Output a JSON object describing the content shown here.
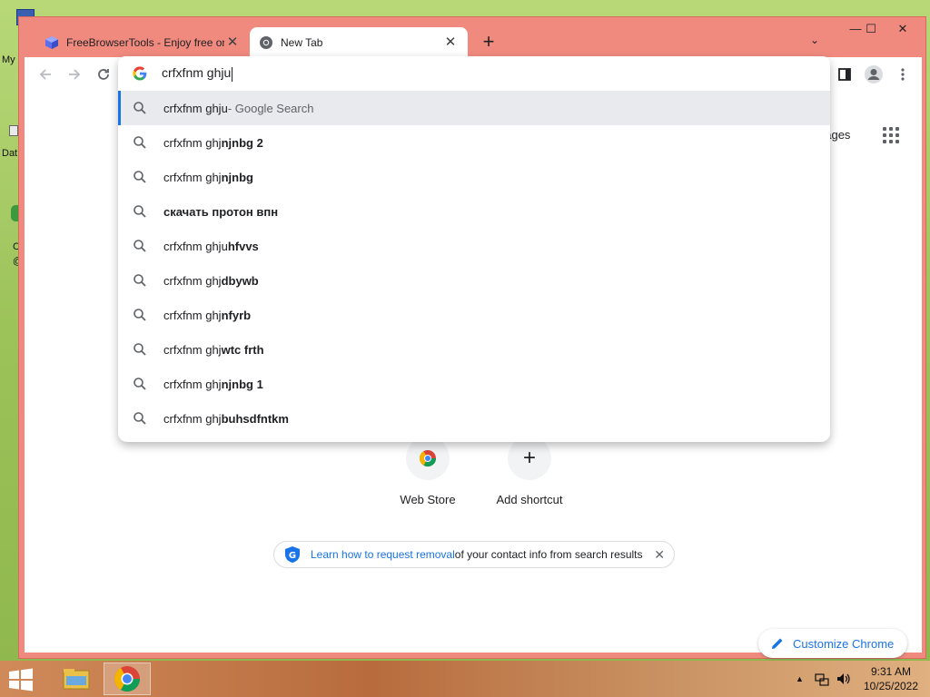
{
  "desktop": {
    "labels": [
      "My",
      "Dat",
      "C",
      "@"
    ]
  },
  "window": {
    "tabs": [
      {
        "title": "FreeBrowserTools - Enjoy free on",
        "close": "✕",
        "active": false
      },
      {
        "title": "New Tab",
        "close": "✕",
        "active": true
      }
    ],
    "new_tab_glyph": "+",
    "tab_list_glyph": "⌄",
    "controls": {
      "minimize": "—",
      "maximize": "☐",
      "close": "✕"
    }
  },
  "toolbar": {
    "back_icon": "arrow-left-icon",
    "forward_icon": "arrow-right-icon",
    "reload_icon": "reload-icon",
    "side_panel_icon": "side-panel-icon",
    "profile_icon": "profile-icon",
    "menu_icon": "kebab-menu-icon"
  },
  "omnibox": {
    "input_value": "crfxfnm ghju",
    "suggestions": [
      {
        "prefix": "crfxfnm ghju",
        "rest": "",
        "hint": " - Google Search",
        "selected": true
      },
      {
        "prefix": "crfxfnm ghj",
        "rest": "njnbg 2",
        "hint": ""
      },
      {
        "prefix": "crfxfnm ghj",
        "rest": "njnbg",
        "hint": ""
      },
      {
        "prefix": "",
        "rest": "скачать протон впн",
        "hint": ""
      },
      {
        "prefix": "crfxfnm ghju",
        "rest": "hfvvs",
        "hint": ""
      },
      {
        "prefix": "crfxfnm ghj",
        "rest": "dbywb",
        "hint": ""
      },
      {
        "prefix": "crfxfnm ghj",
        "rest": "nfyrb",
        "hint": ""
      },
      {
        "prefix": "crfxfnm ghj",
        "rest": "wtc frth",
        "hint": ""
      },
      {
        "prefix": "crfxfnm ghj",
        "rest": "njnbg 1",
        "hint": ""
      },
      {
        "prefix": "crfxfnm ghj",
        "rest": "buhsdfntkm",
        "hint": ""
      }
    ]
  },
  "content": {
    "images_label": "nages",
    "shortcuts": [
      {
        "label": "Web Store"
      },
      {
        "label": "Add shortcut",
        "glyph": "+"
      }
    ],
    "notice": {
      "link_text": "Learn how to request removal",
      "rest_text": " of your contact info from search results",
      "close": "✕"
    },
    "customize_label": "Customize Chrome"
  },
  "taskbar": {
    "time": "9:31 AM",
    "date": "10/25/2022",
    "tray_arrow": "▲"
  },
  "colors": {
    "window_frame": "#f08a7e",
    "accent_blue": "#1a73e8",
    "selected_row": "#e8eaed"
  }
}
